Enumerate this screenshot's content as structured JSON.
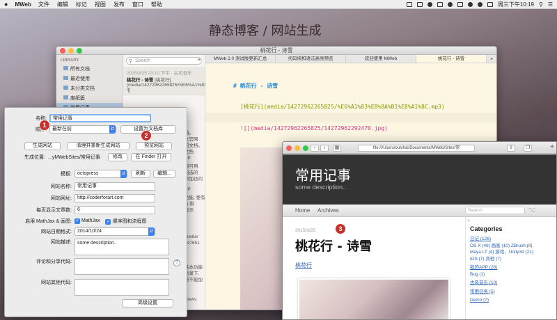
{
  "menubar": {
    "app": "MWeb",
    "menus": [
      "文件",
      "编辑",
      "标记",
      "视图",
      "发布",
      "窗口",
      "帮助"
    ],
    "clock": "周三下午10:19"
  },
  "banner": "静态博客 / 网站生成",
  "mweb_window": {
    "title": "桃花行 - 诗雪",
    "sidebar": {
      "library_label": "LIBRARY",
      "items": [
        "所有文档",
        "最近使用",
        "未分类文档",
        "废纸篓",
        "常用记事"
      ]
    },
    "search_placeholder": "Search",
    "list_item": {
      "meta": "2015/3/25 23:10 下午 · 古风音乐",
      "title": "桃花行 - 诗雪",
      "body": "[桃花行](media/14272962265825/%E6%A1%83%E8%8A%B1%E8%A1%8C.mp3) ![]"
    },
    "list_fragments": [
      "档。",
      "文官网",
      "的文档。",
      "文档",
      "PP",
      "到可用",
      "自选的",
      "添加访问",
      "PP",
      "功能, 要有",
      "ta 和",
      "显示",
      "media/",
      "347651",
      "P",
      "基本功能",
      "目录下,",
      "整不能加",
      "Views",
      "1137)"
    ],
    "tabs": [
      "MWeb 2.0 测试版更新汇总",
      "代码块和语法高亮预览",
      "欢迎使用 MWeb",
      "桃花行 - 诗雪"
    ],
    "editor": {
      "heading": "# 桃花行 - 诗雪",
      "line2": "[桃花行](media/14272962265825/%E6%A1%83%E8%8A%B1%E8%A1%8C.mp3)",
      "line3": "![](media/14272962265825/14272962292470.jpg)"
    }
  },
  "settings": {
    "name_label": "名称:",
    "name_value": "常用记事",
    "order_label": "顺序:",
    "order_value": "最新在前",
    "set_doc_root": "设置为文档库",
    "btn_generate": "生成网站",
    "btn_regen": "清理并重新生成网站",
    "btn_preview": "预览网站",
    "location_label": "生成位置:",
    "location_value": "...yMWebSites/常用记事",
    "btn_modify": "修改",
    "btn_finder": "在 Finder 打开",
    "template_label": "模板:",
    "template_value": "octopress",
    "btn_refresh": "刷新",
    "btn_edit": "编辑...",
    "site_name_label": "网站名称:",
    "site_name_value": "常用记事",
    "site_url_label": "网站网址:",
    "site_url_value": "http://coderforart.com",
    "per_page_label": "每页显示文章数:",
    "per_page_value": "6",
    "mathjax_label": "启用 MathJax & 画图:",
    "mathjax_opt": "MathJax",
    "flow_opt": "顺序图和流程图",
    "date_label": "网站日期格式:",
    "date_value": "2014/10/24",
    "desc_label": "网站描述:",
    "desc_value": "some description..",
    "comment_label": "评论和分享代码:",
    "other_label": "网站其他代码:",
    "btn_advanced": "高级设置",
    "help": "?",
    "badges": [
      "1",
      "2",
      "3"
    ]
  },
  "browser": {
    "url": "file:///Users/oulvhai/Documents/MWeb/Sites/常",
    "site_title": "常用记事",
    "site_subtitle": "some description..",
    "nav": [
      "Home",
      "Archives"
    ],
    "search_placeholder": "Search",
    "post_date": "2015/3/25",
    "post_title": "桃花行 - 诗雪",
    "post_link": "桃花行",
    "categories_title": "Categories",
    "categories": [
      {
        "text": "日记 (126)",
        "main": true
      },
      {
        "text": "OS X (48)   画画 (10)   ZBrush (9)",
        "main": false
      },
      {
        "text": "Maya LT (4)   游戏、Unity3d (21)",
        "main": false
      },
      {
        "text": "iOS (7)   其他 (7)",
        "main": false
      },
      {
        "text": "我的APP (28)",
        "main": true
      },
      {
        "text": "Bug (1)",
        "main": false
      },
      {
        "text": "古风音乐 (10)",
        "main": true
      },
      {
        "text": "常用任务 (5)",
        "main": true
      },
      {
        "text": "Demo (7)",
        "main": true
      }
    ]
  }
}
